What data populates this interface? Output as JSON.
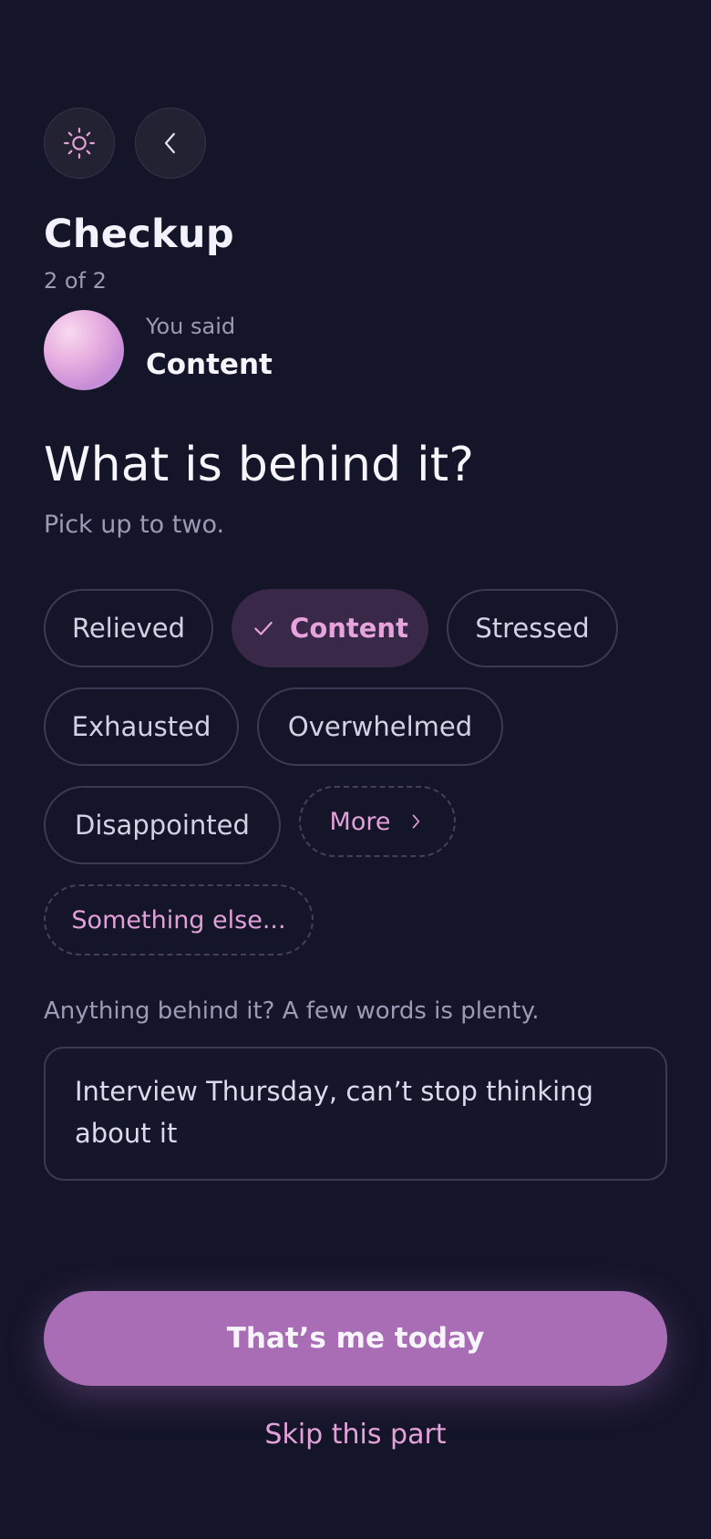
{
  "header": {
    "theme_icon": "sun-icon",
    "back_icon": "chevron-left-icon"
  },
  "checkup": {
    "title": "Checkup",
    "step": "2 of 2",
    "you_said_label": "You said",
    "you_said_value": "Content"
  },
  "question": {
    "title": "What is behind it?",
    "hint": "Pick up to two."
  },
  "chips": [
    {
      "label": "Relieved",
      "selected": false
    },
    {
      "label": "Content",
      "selected": true
    },
    {
      "label": "Stressed",
      "selected": false
    },
    {
      "label": "Exhausted",
      "selected": false
    },
    {
      "label": "Overwhelmed",
      "selected": false
    },
    {
      "label": "Disappointed",
      "selected": false
    }
  ],
  "more_label": "More",
  "something_else_label": "Something else...",
  "notes": {
    "prompt": "Anything behind it? A few words is plenty.",
    "value": "Interview Thursday, can’t stop thinking about it"
  },
  "actions": {
    "primary_label": "That’s me today",
    "skip_label": "Skip this part"
  },
  "colors": {
    "background": "#15152a",
    "accent": "#a86db5",
    "accent_text": "#e3a2d8",
    "selected_chip_bg": "#3a2848"
  }
}
